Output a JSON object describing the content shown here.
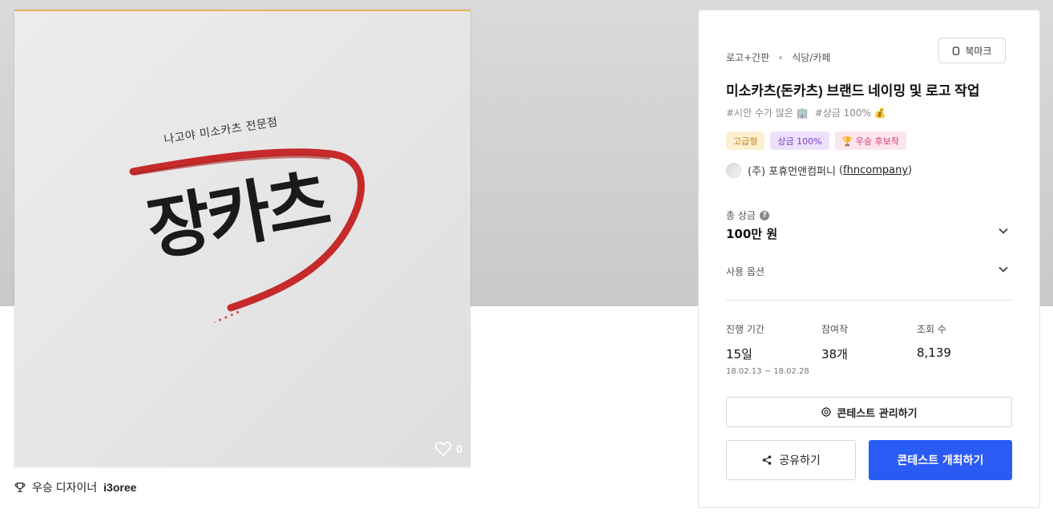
{
  "artwork": {
    "logo_subtitle": "나고야 미소카츠 전문점",
    "logo_text": "장카츠",
    "like_count": "0",
    "like_icon": "heart-icon"
  },
  "winner": {
    "icon": "trophy-icon",
    "label": "우승 디자이너",
    "name": "i3oree"
  },
  "panel": {
    "breadcrumb": [
      "로고+간판",
      "식당/카페"
    ],
    "bookmark_label": "북마크",
    "title": "미소카츠(돈카츠) 브랜드 네이밍 및 로고 작업",
    "hashtags": [
      "#시안 수가 많은 🏢",
      "#상금 100% 💰"
    ],
    "badges": {
      "premium": "고급형",
      "prize": "상금 100%",
      "candidate": "🏆 우승 후보작"
    },
    "company": {
      "name": "(주) 포휴먼앤컴퍼니",
      "handle": "fhncompany",
      "open_paren": "(",
      "close_paren": ")"
    },
    "total_prize": {
      "label": "총 상금",
      "value": "100만 원"
    },
    "usage_option": {
      "label": "사용 옵션"
    },
    "stats": {
      "period": {
        "label": "진행 기간",
        "value": "15일",
        "range": "18.02.13 ~ 18.02.28"
      },
      "entries": {
        "label": "참여작",
        "value": "38개"
      },
      "views": {
        "label": "조회 수",
        "value": "8,139"
      }
    },
    "manage_button": "콘테스트 관리하기",
    "share_button": "공유하기",
    "host_button": "콘테스트 개최하기",
    "accent_color": "#2a5bf5"
  }
}
